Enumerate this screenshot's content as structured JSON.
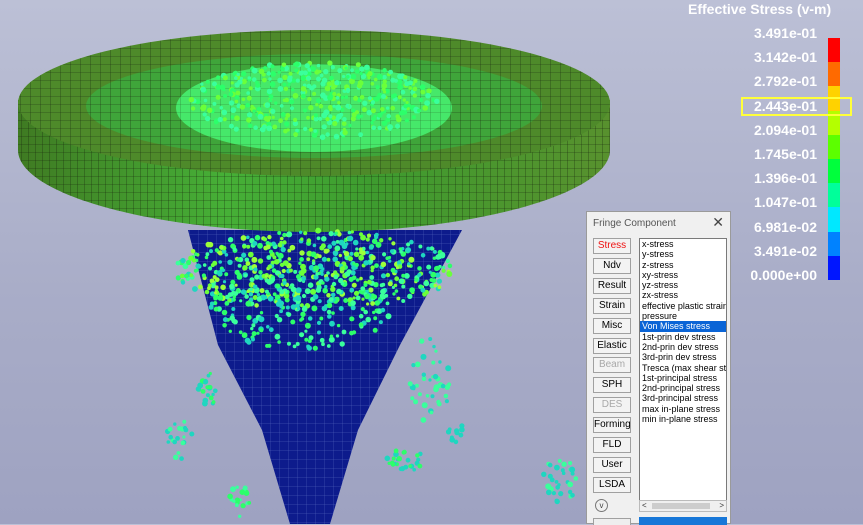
{
  "legend": {
    "title": "Effective Stress (v-m)",
    "labels": [
      "3.491e-01",
      "3.142e-01",
      "2.792e-01",
      "2.443e-01",
      "2.094e-01",
      "1.745e-01",
      "1.396e-01",
      "1.047e-01",
      "6.981e-02",
      "3.491e-02",
      "0.000e+00"
    ],
    "colors": [
      "#ff0000",
      "#ff6a00",
      "#ffd200",
      "#b4ff00",
      "#5cff00",
      "#00ff3c",
      "#00ff9a",
      "#00e8ff",
      "#0082ff",
      "#0016ff"
    ],
    "highlight_color": "#ffff3a",
    "highlighted_label": "2.443e-01"
  },
  "dialog": {
    "title": "Fringe Component",
    "close_glyph": "✕",
    "categories": [
      {
        "label": "Stress",
        "state": "active"
      },
      {
        "label": "Ndv",
        "state": "normal"
      },
      {
        "label": "Result",
        "state": "normal"
      },
      {
        "label": "Strain",
        "state": "normal"
      },
      {
        "label": "Misc",
        "state": "normal"
      },
      {
        "label": "Elastic",
        "state": "normal"
      },
      {
        "label": "Beam",
        "state": "disabled"
      },
      {
        "label": "SPH",
        "state": "normal"
      },
      {
        "label": "DES",
        "state": "disabled"
      },
      {
        "label": "Forming",
        "state": "normal"
      },
      {
        "label": "FLD",
        "state": "normal"
      },
      {
        "label": "User",
        "state": "normal"
      },
      {
        "label": "LSDA",
        "state": "normal"
      }
    ],
    "components": [
      "x-stress",
      "y-stress",
      "z-stress",
      "xy-stress",
      "yz-stress",
      "zx-stress",
      "effective plastic strain",
      "pressure",
      "Von Mises stress",
      "1st-prin dev stress",
      "2nd-prin dev stress",
      "3rd-prin dev stress",
      "Tresca (max shear stress)",
      "1st-principal stress",
      "2nd-principal stress",
      "3rd-principal stress",
      "max in-plane stress",
      "min in-plane stress"
    ],
    "selected_component": "Von Mises stress",
    "scroll_left": "<",
    "scroll_right": ">",
    "down_glyph": "v"
  },
  "model": {
    "disk_color": "#4e8a2a",
    "cone_color": "#0d1b8c",
    "particle_colors": [
      "#2cff6a",
      "#6bff3a",
      "#1fd6c0",
      "#3aff9c",
      "#9cff3a"
    ]
  }
}
